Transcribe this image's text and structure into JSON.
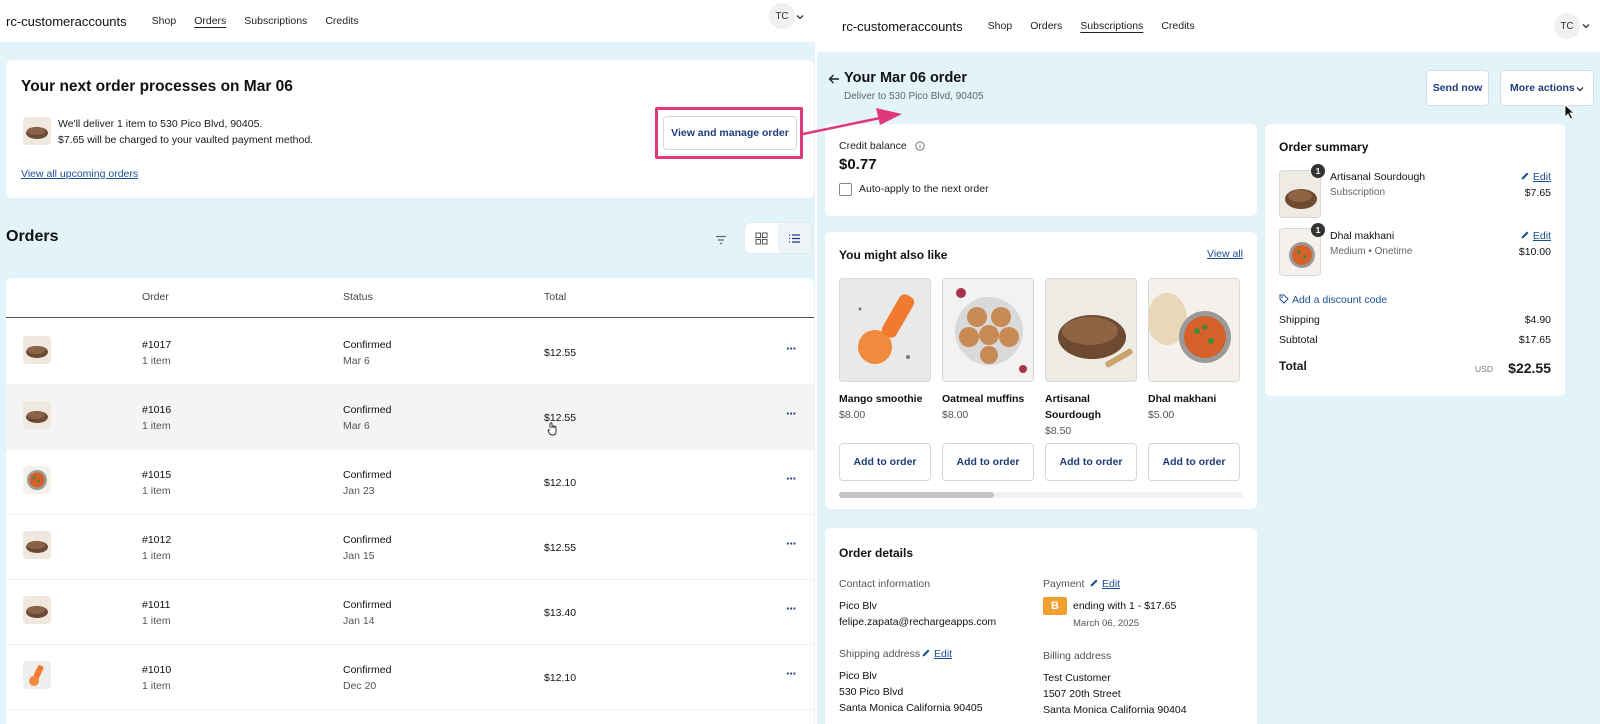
{
  "left": {
    "header": {
      "brand": "rc-customeraccounts",
      "nav": [
        "Shop",
        "Orders",
        "Subscriptions",
        "Credits"
      ],
      "avatar": "TC"
    },
    "next_order": {
      "title": "Your next order processes on Mar 06",
      "line1": "We'll deliver 1 item to 530 Pico Blvd, 90405.",
      "line2": "$7.65 will be charged to your vaulted payment method.",
      "view_all_link": "View all upcoming orders",
      "manage_button": "View and manage order"
    },
    "orders": {
      "title": "Orders",
      "columns": [
        "Order",
        "Status",
        "Total"
      ],
      "rows": [
        {
          "number": "#1017",
          "items": "1 item",
          "status": "Confirmed",
          "date": "Mar 6",
          "total": "$12.55"
        },
        {
          "number": "#1016",
          "items": "1 item",
          "status": "Confirmed",
          "date": "Mar 6",
          "total": "$12.55"
        },
        {
          "number": "#1015",
          "items": "1 item",
          "status": "Confirmed",
          "date": "Jan 23",
          "total": "$12.10"
        },
        {
          "number": "#1012",
          "items": "1 item",
          "status": "Confirmed",
          "date": "Jan 15",
          "total": "$12.55"
        },
        {
          "number": "#1011",
          "items": "1 item",
          "status": "Confirmed",
          "date": "Jan 14",
          "total": "$13.40"
        },
        {
          "number": "#1010",
          "items": "1 item",
          "status": "Confirmed",
          "date": "Dec 20",
          "total": "$12.10"
        }
      ],
      "more_glyph": "···"
    }
  },
  "right": {
    "header": {
      "brand": "rc-customeraccounts",
      "nav": [
        "Shop",
        "Orders",
        "Subscriptions",
        "Credits"
      ],
      "avatar": "TC"
    },
    "order": {
      "title": "Your Mar 06 order",
      "subtitle": "Deliver to 530 Pico Blvd, 90405",
      "send_now": "Send now",
      "more_actions": "More actions"
    },
    "credit": {
      "label": "Credit balance",
      "amount": "$0.77",
      "auto_apply": "Auto-apply to the next order"
    },
    "suggestions": {
      "title": "You might also like",
      "view_all": "View all",
      "add_label": "Add to order",
      "products": [
        {
          "name": "Mango smoothie",
          "price": "$8.00"
        },
        {
          "name": "Oatmeal muffins",
          "price": "$8.00"
        },
        {
          "name": "Artisanal Sourdough",
          "price": "$8.50"
        },
        {
          "name": "Dhal makhani",
          "price": "$5.00"
        }
      ]
    },
    "details": {
      "title": "Order details",
      "contact_label": "Contact information",
      "contact_name": "Pico Blv",
      "contact_email": "felipe.zapata@rechargeapps.com",
      "payment_label": "Payment",
      "edit": "Edit",
      "payment_badge": "B",
      "payment_text": "ending with 1 - $17.65",
      "payment_date": "March 06, 2025",
      "shipping_label": "Shipping address",
      "shipping_lines": [
        "Pico Blv",
        "530 Pico Blvd",
        "Santa Monica California 90405"
      ],
      "billing_label": "Billing address",
      "billing_lines": [
        "Test Customer",
        "1507 20th Street",
        "Santa Monica California 90404"
      ]
    },
    "summary": {
      "title": "Order summary",
      "items": [
        {
          "qty": "1",
          "name": "Artisanal Sourdough",
          "sub": "Subscription",
          "price": "$7.65"
        },
        {
          "qty": "1",
          "name": "Dhal makhani",
          "sub": "Medium • Onetime",
          "price": "$10.00"
        }
      ],
      "edit": "Edit",
      "discount": "Add a discount code",
      "shipping_label": "Shipping",
      "shipping_value": "$4.90",
      "subtotal_label": "Subtotal",
      "subtotal_value": "$17.65",
      "total_label": "Total",
      "currency": "USD",
      "total_value": "$22.55"
    }
  },
  "colors": {
    "accent": "#1d3c78",
    "page_bg": "#e3f3fa",
    "highlight": "#e0397a",
    "payment_badge": "#f0a030"
  }
}
